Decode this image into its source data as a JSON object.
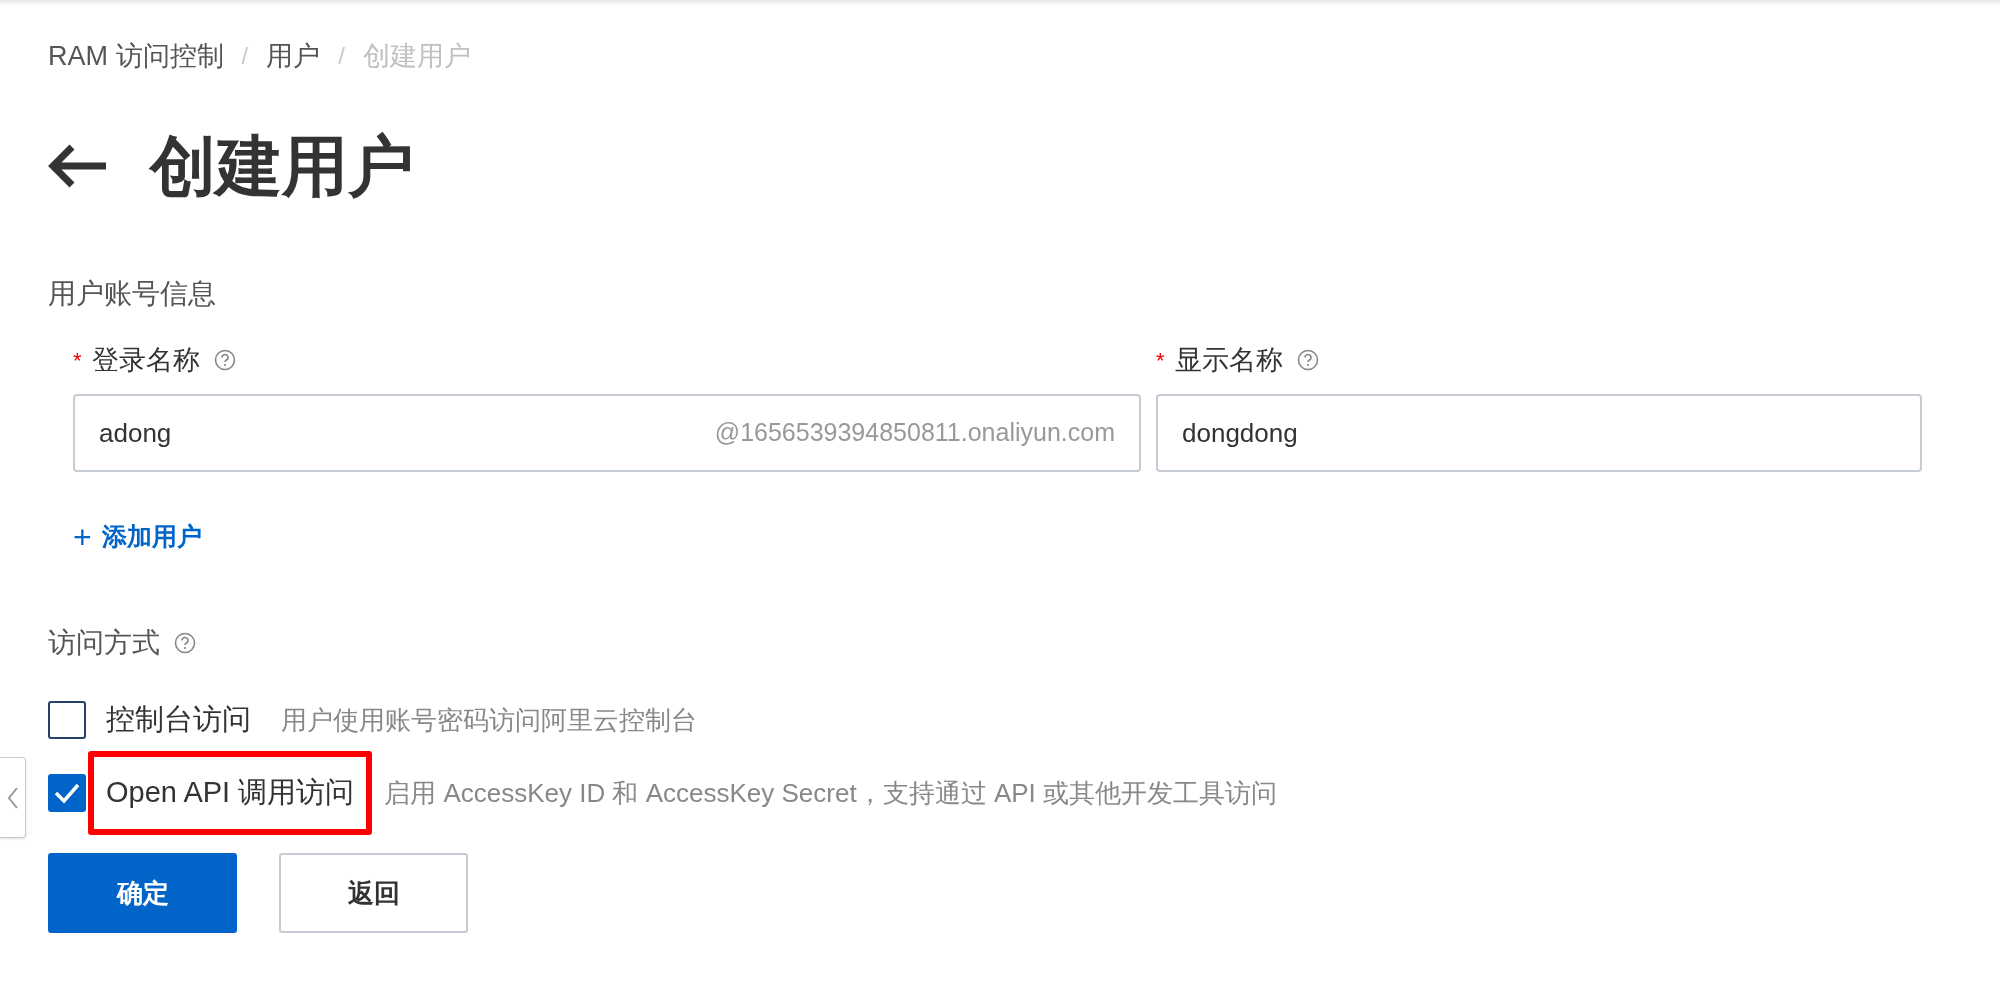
{
  "breadcrumb": [
    {
      "label": "RAM 访问控制",
      "current": false
    },
    {
      "label": "用户",
      "current": false
    },
    {
      "label": "创建用户",
      "current": true
    }
  ],
  "breadcrumb_separator": "/",
  "page_title": "创建用户",
  "section_title": "用户账号信息",
  "fields": [
    {
      "label": "登录名称",
      "required": true,
      "value": "adong",
      "suffix": "@1656539394850811.onaliyun.com"
    },
    {
      "label": "显示名称",
      "required": true,
      "value": "dongdong"
    }
  ],
  "required_mark": "*",
  "add_user": {
    "icon": "+",
    "label": "添加用户"
  },
  "access_title": "访问方式",
  "access_options": [
    {
      "label": "控制台访问",
      "description": "用户使用账号密码访问阿里云控制台",
      "checked": false,
      "highlighted": false
    },
    {
      "label": "Open API 调用访问",
      "description": "启用 AccessKey ID 和 AccessKey Secret，支持通过 API 或其他开发工具访问",
      "checked": true,
      "highlighted": true
    }
  ],
  "buttons": [
    {
      "label": "确定",
      "kind": "primary"
    },
    {
      "label": "返回",
      "kind": "secondary"
    }
  ]
}
